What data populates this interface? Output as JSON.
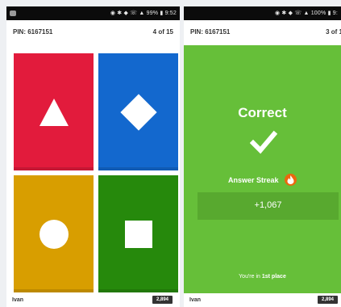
{
  "left_screen": {
    "status": "◉ ✱ ◆ ☏ ▲ 99% ▮ 9:52",
    "pin": "PIN: 6167151",
    "progress": "4 of 15",
    "answers": [
      {
        "color": "#e21b3c",
        "shape": "triangle-icon"
      },
      {
        "color": "#1368ce",
        "shape": "diamond-icon"
      },
      {
        "color": "#d89e00",
        "shape": "circle-icon"
      },
      {
        "color": "#26890c",
        "shape": "square-icon"
      }
    ],
    "player_name": "Ivan",
    "score": "2,894"
  },
  "right_screen": {
    "status": "◉ ✱ ◆ ☏ ▲ 100% ▮ 9:",
    "pin": "PIN: 6167151",
    "progress": "3 of 1",
    "result_title": "Correct",
    "result_icon": "checkmark-icon",
    "streak_label": "Answer Streak",
    "streak_icon": "flame-icon",
    "points": "+1,067",
    "place_prefix": "You're in ",
    "place_value": "1st place",
    "player_name": "Ivan",
    "score": "2,894",
    "background_color": "#66bf39"
  }
}
